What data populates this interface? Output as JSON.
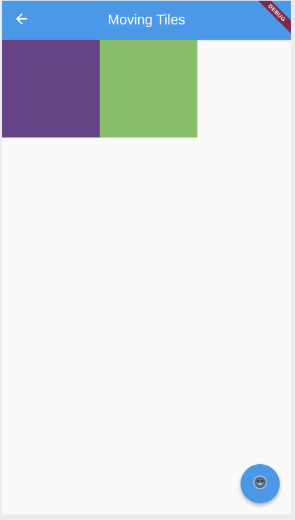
{
  "appbar": {
    "title": "Moving Tiles",
    "back_icon": "arrow-back-icon",
    "color": "#4a98e6"
  },
  "debug_banner": {
    "label": "DEBUG",
    "color": "#7b2a4d"
  },
  "tiles": [
    {
      "color": "#654385"
    },
    {
      "color": "#88be67"
    }
  ],
  "fab": {
    "icon": "face-icon",
    "color": "#4a98e6"
  },
  "background": "#fafafa"
}
